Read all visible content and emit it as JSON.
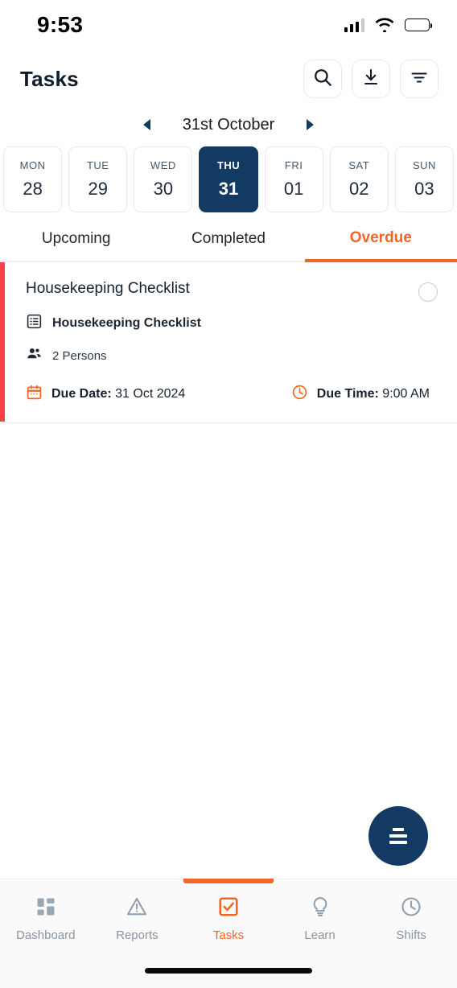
{
  "status_bar": {
    "time": "9:53",
    "signal_icon": "cellular-signal-icon",
    "wifi_icon": "wifi-icon",
    "battery_icon": "battery-icon"
  },
  "header": {
    "title": "Tasks",
    "actions": [
      {
        "name": "search-icon",
        "label": "Search"
      },
      {
        "name": "download-icon",
        "label": "Download"
      },
      {
        "name": "filter-icon",
        "label": "Filter"
      }
    ]
  },
  "date_nav": {
    "prev_label": "Previous week",
    "current_date": "31st October",
    "next_label": "Next week"
  },
  "day_strip": [
    {
      "dow": "MON",
      "date": "28",
      "selected": false
    },
    {
      "dow": "TUE",
      "date": "29",
      "selected": false
    },
    {
      "dow": "WED",
      "date": "30",
      "selected": false
    },
    {
      "dow": "THU",
      "date": "31",
      "selected": true
    },
    {
      "dow": "FRI",
      "date": "01",
      "selected": false
    },
    {
      "dow": "SAT",
      "date": "02",
      "selected": false
    },
    {
      "dow": "SUN",
      "date": "03",
      "selected": false
    }
  ],
  "tabs": [
    {
      "label": "Upcoming",
      "active": false
    },
    {
      "label": "Completed",
      "active": false
    },
    {
      "label": "Overdue",
      "active": true
    }
  ],
  "tasks": [
    {
      "title": "Housekeeping Checklist",
      "checklist_name": "Housekeeping Checklist",
      "assignees": "2 Persons",
      "due_date_label": "Due Date:",
      "due_date_value": "31 Oct 2024",
      "due_time_label": "Due Time:",
      "due_time_value": "9:00 AM",
      "status_color": "#f8414a",
      "completed": false
    }
  ],
  "fab": {
    "name": "sort-list-icon",
    "label": "Sort"
  },
  "bottom_nav": [
    {
      "label": "Dashboard",
      "icon": "grid-icon",
      "active": false
    },
    {
      "label": "Reports",
      "icon": "warning-triangle-icon",
      "active": false
    },
    {
      "label": "Tasks",
      "icon": "checkbox-icon",
      "active": true
    },
    {
      "label": "Learn",
      "icon": "lightbulb-icon",
      "active": false
    },
    {
      "label": "Shifts",
      "icon": "clock-icon",
      "active": false
    }
  ],
  "colors": {
    "accent_orange": "#f26522",
    "navy": "#123a63",
    "overdue_red": "#f8414a",
    "muted": "#8a949e"
  }
}
